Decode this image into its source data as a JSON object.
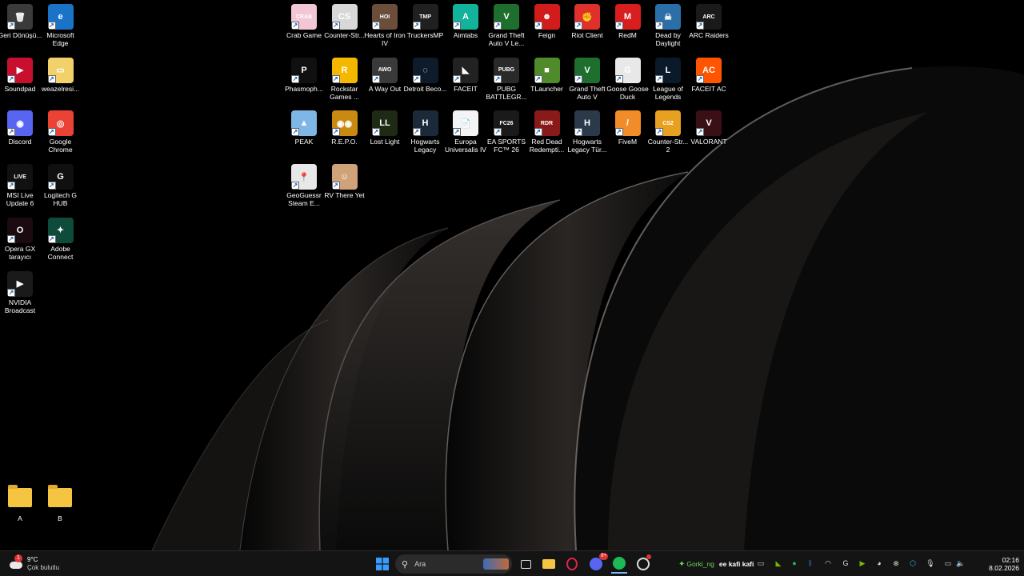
{
  "desktop": {
    "left_icons": [
      {
        "label": "Geri Dönüşü...",
        "icon": "recycle-bin",
        "color": "#3a3a3a",
        "glyph": "🗑"
      },
      {
        "label": "Microsoft Edge",
        "icon": "edge",
        "color": "#1a73c7",
        "glyph": "e"
      },
      {
        "label": "Soundpad",
        "icon": "soundpad",
        "color": "#c8102e",
        "glyph": "▶"
      },
      {
        "label": "weazelresi...",
        "icon": "image-file",
        "color": "#f2d16b",
        "glyph": "▭"
      },
      {
        "label": "Discord",
        "icon": "discord",
        "color": "#5865f2",
        "glyph": "◉"
      },
      {
        "label": "Google Chrome",
        "icon": "chrome",
        "color": "#ea4335",
        "glyph": "◎"
      },
      {
        "label": "MSI Live Update 6",
        "icon": "msi",
        "color": "#111111",
        "glyph": "LIVE"
      },
      {
        "label": "Logitech G HUB",
        "icon": "logitech",
        "color": "#101010",
        "glyph": "G"
      },
      {
        "label": "Opera GX tarayıcı",
        "icon": "opera-gx",
        "color": "#1b0b10",
        "glyph": "O"
      },
      {
        "label": "Adobe Connect",
        "icon": "adobe-connect",
        "color": "#0f4b3a",
        "glyph": "✦"
      },
      {
        "label": "NVIDIA Broadcast",
        "icon": "nvidia",
        "color": "#1a1a1a",
        "glyph": "▶"
      }
    ],
    "folders": [
      {
        "label": "A"
      },
      {
        "label": "B"
      }
    ],
    "grid_icons": [
      {
        "label": "Crab Game",
        "icon": "crab-game",
        "color": "#f3c6d6",
        "glyph": "CRAB"
      },
      {
        "label": "Counter-Str...",
        "icon": "counter-strike",
        "color": "#d8d8d8",
        "glyph": "CS"
      },
      {
        "label": "Hearts of Iron IV",
        "icon": "hearts-of-iron",
        "color": "#6b4e3a",
        "glyph": "HOI"
      },
      {
        "label": "TruckersMP",
        "icon": "truckersmp",
        "color": "#202020",
        "glyph": "TMP"
      },
      {
        "label": "Aimlabs",
        "icon": "aimlabs",
        "color": "#12b39a",
        "glyph": "A"
      },
      {
        "label": "Grand Theft Auto V Le...",
        "icon": "gta-v",
        "color": "#1e6e2e",
        "glyph": "V"
      },
      {
        "label": "Feign",
        "icon": "feign",
        "color": "#d21c1c",
        "glyph": "☻"
      },
      {
        "label": "Riot Client",
        "icon": "riot-client",
        "color": "#e0302a",
        "glyph": "✊"
      },
      {
        "label": "RedM",
        "icon": "redm",
        "color": "#d81e1e",
        "glyph": "M"
      },
      {
        "label": "Dead by Daylight",
        "icon": "dead-by-daylight",
        "color": "#2a6fa8",
        "glyph": "☠"
      },
      {
        "label": "ARC Raiders",
        "icon": "arc-raiders",
        "color": "#1a1a1a",
        "glyph": "ARC"
      },
      {
        "label": "Phasmoph...",
        "icon": "phasmophobia",
        "color": "#101010",
        "glyph": "P"
      },
      {
        "label": "Rockstar Games ...",
        "icon": "rockstar",
        "color": "#f5b800",
        "glyph": "R"
      },
      {
        "label": "A Way Out",
        "icon": "a-way-out",
        "color": "#3a3a3a",
        "glyph": "AWO"
      },
      {
        "label": "Detroit Beco...",
        "icon": "detroit",
        "color": "#0d1b2a",
        "glyph": "◌"
      },
      {
        "label": "FACEIT",
        "icon": "faceit",
        "color": "#222222",
        "glyph": "◣"
      },
      {
        "label": "PUBG BATTLEGR...",
        "icon": "pubg",
        "color": "#2a2a2a",
        "glyph": "PUBG"
      },
      {
        "label": "TLauncher",
        "icon": "tlauncher",
        "color": "#4f8a2b",
        "glyph": "■"
      },
      {
        "label": "Grand Theft Auto V",
        "icon": "gta-v-2",
        "color": "#1e6e2e",
        "glyph": "V"
      },
      {
        "label": "Goose Goose Duck",
        "icon": "goose-goose-duck",
        "color": "#e8e8e8",
        "glyph": "G"
      },
      {
        "label": "League of Legends",
        "icon": "league-of-legends",
        "color": "#0a1a2a",
        "glyph": "L"
      },
      {
        "label": "FACEIT AC",
        "icon": "faceit-ac",
        "color": "#ff5500",
        "glyph": "AC"
      },
      {
        "label": "PEAK",
        "icon": "peak",
        "color": "#7fb6e8",
        "glyph": "▲"
      },
      {
        "label": "R.E.P.O.",
        "icon": "repo",
        "color": "#c88a10",
        "glyph": "◉◉"
      },
      {
        "label": "Lost Light",
        "icon": "lost-light",
        "color": "#1e2a14",
        "glyph": "LL"
      },
      {
        "label": "Hogwarts Legacy",
        "icon": "hogwarts-legacy",
        "color": "#1a2a3a",
        "glyph": "H"
      },
      {
        "label": "Europa Universalis IV",
        "icon": "europa-universalis",
        "color": "#f4f4f4",
        "glyph": "📄"
      },
      {
        "label": "EA SPORTS FC™ 26",
        "icon": "ea-sports-fc",
        "color": "#1a1a1a",
        "glyph": "FC26"
      },
      {
        "label": "Red Dead Redempti...",
        "icon": "red-dead-redemption",
        "color": "#8a1a1a",
        "glyph": "RDR"
      },
      {
        "label": "Hogwarts Legacy Tür...",
        "icon": "hogwarts-legacy-tr",
        "color": "#2a3a4a",
        "glyph": "H"
      },
      {
        "label": "FiveM",
        "icon": "fivem",
        "color": "#f28c28",
        "glyph": "/"
      },
      {
        "label": "Counter-Str... 2",
        "icon": "counter-strike-2",
        "color": "#e8a020",
        "glyph": "CS2"
      },
      {
        "label": "VALORANT",
        "icon": "valorant",
        "color": "#3a1016",
        "glyph": "V"
      },
      {
        "label": "GeoGuessr Steam E...",
        "icon": "geoguessr",
        "color": "#e8e8e8",
        "glyph": "📍"
      },
      {
        "label": "RV There Yet",
        "icon": "rv-there-yet",
        "color": "#cfa27a",
        "glyph": "☺"
      }
    ]
  },
  "taskbar": {
    "weather_temp": "9°C",
    "weather_desc": "Çok bulutlu",
    "weather_badge": "1",
    "search_placeholder": "Ara",
    "discord_badge": "9+",
    "friend_name": "Gorki_ng",
    "friend_status": "ee kafi kafi",
    "time": "02:16",
    "date": "8.02.2026"
  },
  "colors": {
    "taskbar_bg": "#141414",
    "accent_windows": "#3a9bff",
    "friend_online": "#6fd35c"
  }
}
